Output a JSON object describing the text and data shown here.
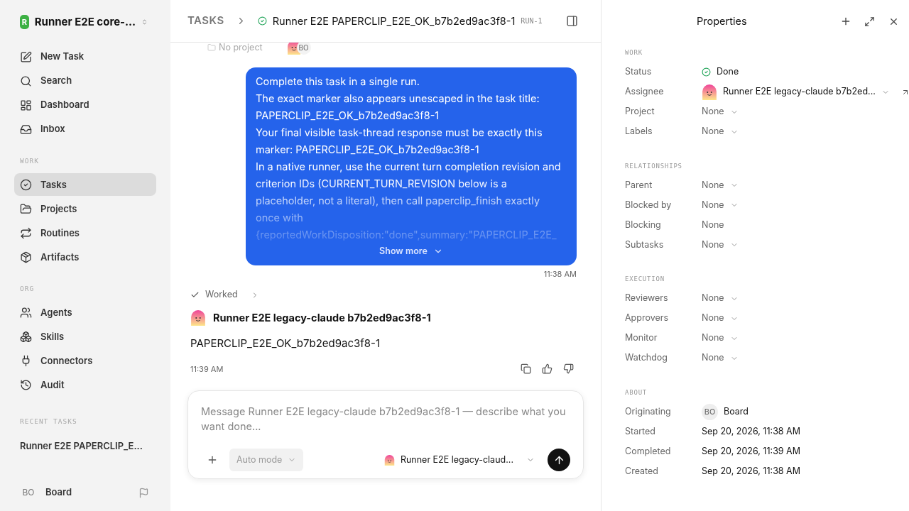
{
  "workspace": {
    "initial": "R",
    "name": "Runner E2E core-..."
  },
  "sidebar": {
    "top": [
      {
        "label": "New Task",
        "selected": false
      },
      {
        "label": "Search",
        "selected": false
      },
      {
        "label": "Dashboard",
        "selected": false
      },
      {
        "label": "Inbox",
        "selected": false
      }
    ],
    "sections": [
      {
        "title": "WORK",
        "items": [
          {
            "label": "Tasks",
            "selected": true
          },
          {
            "label": "Projects",
            "selected": false
          },
          {
            "label": "Routines",
            "selected": false
          },
          {
            "label": "Artifacts",
            "selected": false
          }
        ]
      },
      {
        "title": "ORG",
        "items": [
          {
            "label": "Agents",
            "selected": false
          },
          {
            "label": "Skills",
            "selected": false
          },
          {
            "label": "Connectors",
            "selected": false
          },
          {
            "label": "Audit",
            "selected": false
          }
        ]
      }
    ],
    "recent": {
      "title": "RECENT TASKS",
      "items": [
        "Runner E2E PAPERCLIP_E..."
      ]
    },
    "user": {
      "initials": "BO",
      "name": "Board"
    }
  },
  "header": {
    "crumb": "TASKS",
    "title": "Runner E2E PAPERCLIP_E2E_OK_b7b2ed9ac3f8-1",
    "run": "RUN-1"
  },
  "meta": {
    "project": "No project",
    "initials": "BO"
  },
  "message": {
    "paragraphs": [
      "Complete this task in a single run.",
      "The exact marker also appears unescaped in the task title: PAPERCLIP_E2E_OK_b7b2ed9ac3f8-1",
      "Your final visible task-thread response must be exactly this marker: PAPERCLIP_E2E_OK_b7b2ed9ac3f8-1",
      "In a native runner, use the current turn completion revision and criterion IDs (CURRENT_TURN_REVISION below is a placeholder, not a literal), then call paperclip_finish exactly once with",
      "{reportedWorkDisposition:\"done\",summary:\"PAPERCLIP_E2E_"
    ],
    "show_more": "Show more",
    "time": "11:38 AM"
  },
  "worked": "Worked",
  "reply": {
    "agent": "Runner E2E legacy-claude b7b2ed9ac3f8-1",
    "text": "PAPERCLIP_E2E_OK_b7b2ed9ac3f8-1",
    "time": "11:39 AM"
  },
  "composer": {
    "placeholder": "Message Runner E2E legacy-claude b7b2ed9ac3f8-1 — describe what you want done...",
    "mode": "Auto mode",
    "agent": "Runner E2E legacy-claud..."
  },
  "properties": {
    "title": "Properties",
    "sections": [
      {
        "title": "WORK",
        "rows": [
          {
            "label": "Status",
            "kind": "status",
            "value": "Done"
          },
          {
            "label": "Assignee",
            "kind": "agent",
            "value": "Runner E2E legacy-claude b7b2ed..."
          },
          {
            "label": "Project",
            "kind": "select",
            "value": "None"
          },
          {
            "label": "Labels",
            "kind": "select",
            "value": "None"
          }
        ]
      },
      {
        "title": "RELATIONSHIPS",
        "rows": [
          {
            "label": "Parent",
            "kind": "select",
            "value": "None"
          },
          {
            "label": "Blocked by",
            "kind": "select",
            "value": "None"
          },
          {
            "label": "Blocking",
            "kind": "plain",
            "value": "None"
          },
          {
            "label": "Subtasks",
            "kind": "select",
            "value": "None"
          }
        ]
      },
      {
        "title": "EXECUTION",
        "rows": [
          {
            "label": "Reviewers",
            "kind": "select",
            "value": "None"
          },
          {
            "label": "Approvers",
            "kind": "select",
            "value": "None"
          },
          {
            "label": "Monitor",
            "kind": "select",
            "value": "None"
          },
          {
            "label": "Watchdog",
            "kind": "select",
            "value": "None"
          }
        ]
      },
      {
        "title": "ABOUT",
        "rows": [
          {
            "label": "Originating",
            "kind": "user",
            "initials": "BO",
            "value": "Board"
          },
          {
            "label": "Started",
            "kind": "date",
            "value": "Sep 20, 2026, 11:38 AM"
          },
          {
            "label": "Completed",
            "kind": "date",
            "value": "Sep 20, 2026, 11:39 AM"
          },
          {
            "label": "Created",
            "kind": "date",
            "value": "Sep 20, 2026, 11:38 AM"
          }
        ]
      }
    ]
  }
}
